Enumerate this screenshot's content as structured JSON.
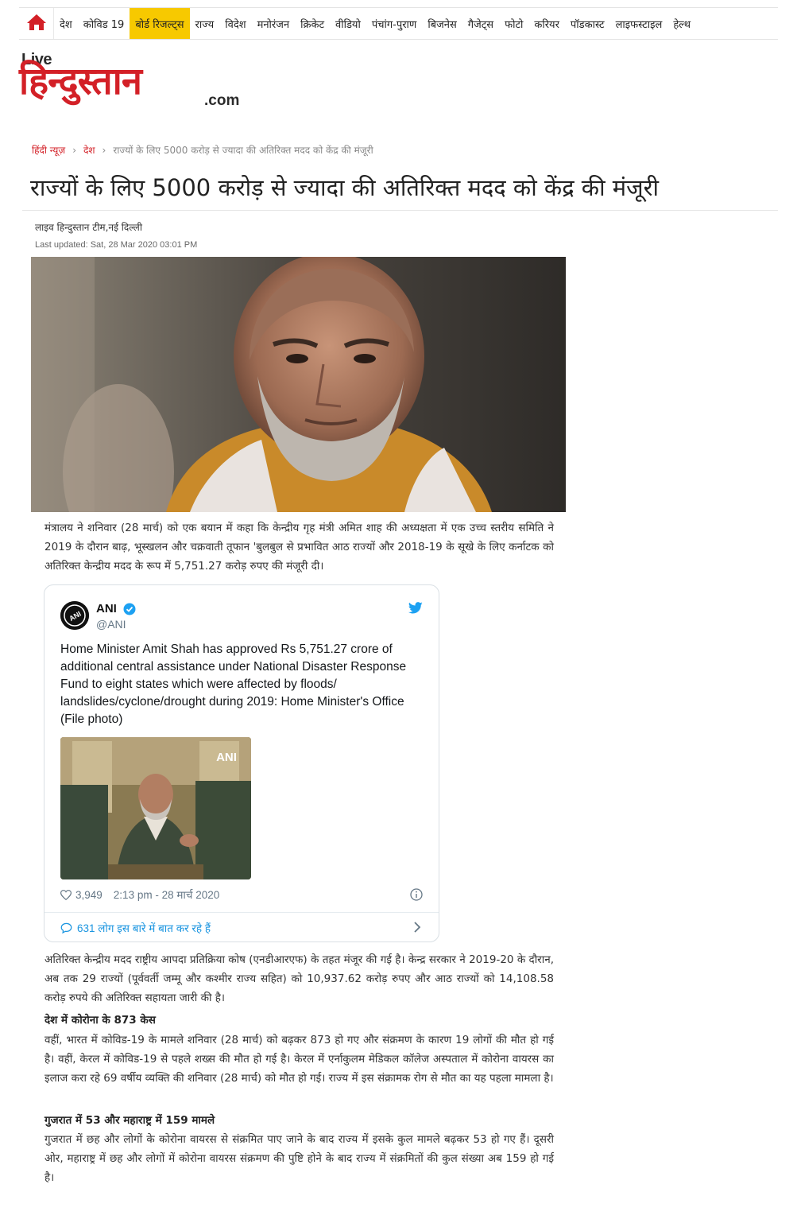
{
  "nav": {
    "items": [
      "देश",
      "कोविड 19",
      "बोर्ड रिजल्ट्स",
      "राज्य",
      "विदेश",
      "मनोरंजन",
      "क्रिकेट",
      "वीडियो",
      "पंचांग-पुराण",
      "बिजनेस",
      "गैजेट्स",
      "फोटो",
      "करियर",
      "पॉडकास्ट",
      "लाइफस्टाइल",
      "हेल्थ"
    ],
    "active_index": 2
  },
  "logo": {
    "live": "Live",
    "main": "हिन्दुस्तान",
    "com": ".com"
  },
  "breadcrumb": {
    "home": "हिंदी न्यूज़",
    "section": "देश",
    "current": "राज्यों के लिए 5000 करोड़ से ज्यादा की अतिरिक्त मदद को केंद्र की मंजूरी"
  },
  "article": {
    "headline": "राज्यों के लिए 5000 करोड़ से ज्यादा की अतिरिक्त मदद को केंद्र की मंजूरी",
    "byline": "लाइव हिन्दुस्तान टीम,नई दिल्ली",
    "updated": "Last updated:  Sat, 28 Mar 2020 03:01 PM",
    "para1": "मंत्रालय ने शनिवार (28 मार्च) को एक बयान में कहा कि केन्द्रीय गृह मंत्री अमित शाह की अध्यक्षता में एक उच्च स्तरीय समिति ने 2019 के दौरान बाढ़, भूस्खलन और चक्रवाती तूफान 'बुलबुल से प्रभावित आठ राज्यों और 2018-19 के सूखे के लिए कर्नाटक को अतिरिक्त केन्द्रीय मदद के रूप में 5,751.27 करोड़ रुपए की मंजूरी दी।",
    "para2": "अतिरिक्त केन्द्रीय मदद राष्ट्रीय आपदा प्रतिक्रिया कोष (एनडीआरएफ) के तहत मंजूर की गई है। केन्द्र सरकार ने 2019-20 के दौरान, अब तक 29 राज्यों (पूर्ववर्ती जम्मू और कश्मीर राज्य सहित) को 10,937.62 करोड़ रुपए और आठ राज्यों को 14,108.58 करोड़ रुपये की अतिरिक्त सहायता जारी की है।",
    "subhead1": "देश में कोरोना के 873 केस",
    "para3": "वहीं, भारत में कोविड-19 के मामले शनिवार (28 मार्च) को बढ़कर 873 हो गए और संक्रमण के कारण 19 लोगों की मौत हो गई है। वहीं, केरल में कोविड-19 से पहले शख्स की मौत हो गई है। केरल में एर्नाकुलम मेडिकल कॉलेज अस्पताल में कोरोना वायरस का इलाज करा रहे 69 वर्षीय व्यक्ति की शनिवार (28 मार्च) को मौत हो गई। राज्य में इस संक्रामक रोग से मौत का यह पहला मामला है।",
    "subhead2": "गुजरात में 53 और महाराष्ट्र में 159 मामले",
    "para4": "गुजरात में छह और लोगों के कोरोना वायरस से संक्रमित पाए जाने के बाद राज्य में इसके कुल मामले बढ़कर 53 हो गए हैं। दूसरी ओर, महाराष्ट्र में छह और लोगों में कोरोना वायरस संक्रमण की पुष्टि होने के बाद राज्य में संक्रमितों की कुल संख्या अब 159 हो गई है।"
  },
  "tweet": {
    "name": "ANI",
    "handle": "@ANI",
    "avatar_text": "ANI",
    "image_watermark": "ANI",
    "text": "Home Minister Amit Shah has approved Rs 5,751.27 crore of additional central assistance under National Disaster Response Fund to eight states which were affected by floods/ landslides/cyclone/drought during 2019: Home Minister's Office (File photo)",
    "likes": "3,949",
    "time": "2:13 pm - 28 मार्च 2020",
    "talk": "631 लोग इस बारे में बात कर रहे हैं"
  },
  "colors": {
    "brand_red": "#d32027",
    "nav_active": "#f7c900",
    "twitter_blue": "#1da1f2"
  }
}
